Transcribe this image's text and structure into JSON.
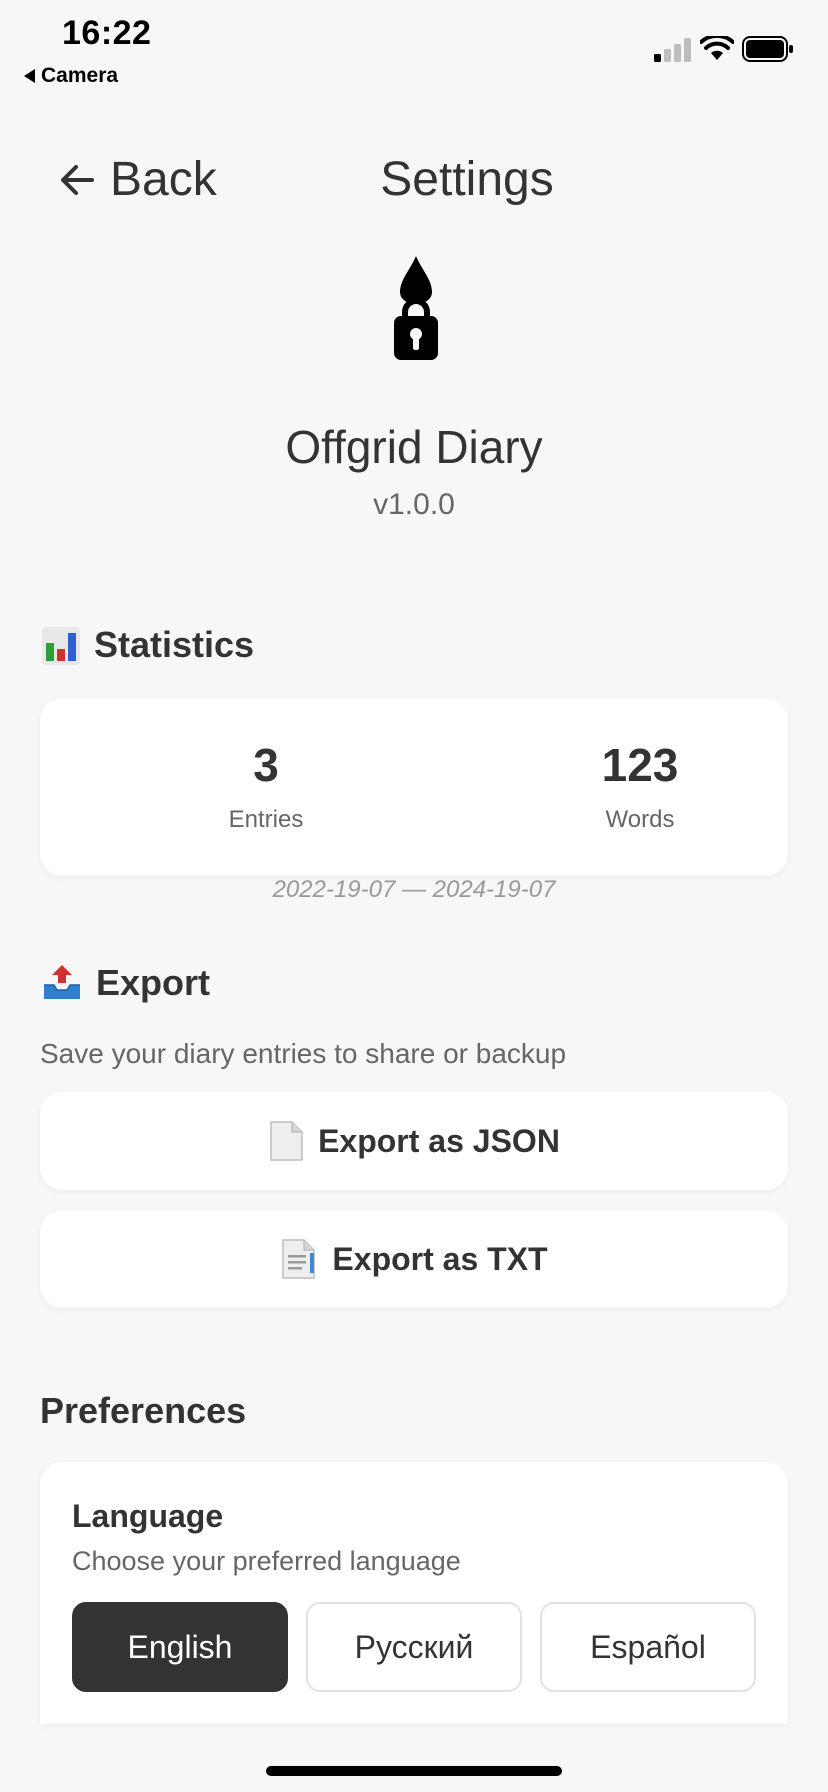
{
  "status_bar": {
    "time": "16:22",
    "back_app": "Camera"
  },
  "header": {
    "back_label": "Back",
    "title": "Settings"
  },
  "app": {
    "name": "Offgrid Diary",
    "version": "v1.0.0"
  },
  "statistics": {
    "title": "Statistics",
    "entries_value": "3",
    "entries_label": "Entries",
    "words_value": "123",
    "words_label": "Words",
    "date_range": "2022-19-07 — 2024-19-07"
  },
  "export": {
    "title": "Export",
    "description": "Save your diary entries to share or backup",
    "json_label": "Export as JSON",
    "txt_label": "Export as TXT"
  },
  "preferences": {
    "title": "Preferences",
    "language_label": "Language",
    "language_description": "Choose your preferred language",
    "languages": [
      "English",
      "Русский",
      "Español"
    ],
    "selected_language": "English"
  },
  "colors": {
    "background": "#f7f7f7",
    "card": "#ffffff",
    "text_primary": "#333333",
    "text_secondary": "#666666",
    "selected_button": "#333333"
  }
}
